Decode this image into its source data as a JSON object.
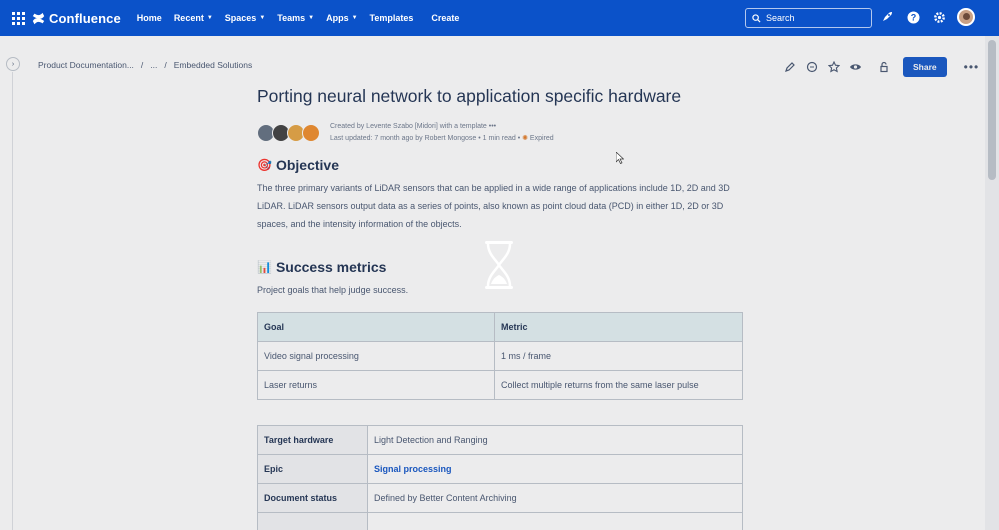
{
  "nav": {
    "brand": "Confluence",
    "items": [
      {
        "label": "Home",
        "has_menu": false
      },
      {
        "label": "Recent",
        "has_menu": true
      },
      {
        "label": "Spaces",
        "has_menu": true
      },
      {
        "label": "Teams",
        "has_menu": true
      },
      {
        "label": "Apps",
        "has_menu": true
      },
      {
        "label": "Templates",
        "has_menu": false
      }
    ],
    "create_label": "Create",
    "search_placeholder": "Search"
  },
  "breadcrumb": {
    "space": "Product Documentation...",
    "sep": "/",
    "ellipsis": "...",
    "page": "Embedded Solutions"
  },
  "toolbar": {
    "share_label": "Share",
    "more_label": "•••"
  },
  "page": {
    "title": "Porting neural network to application specific hardware",
    "created_by": "Created by Levente Szabo [Midori] with a template",
    "created_more": "•••",
    "last_updated": "Last updated: 7 month ago by Robert Mongose",
    "read_time": "1 min read",
    "status": "Expired",
    "avatar_colors": [
      "#5f6d7e",
      "#3a3a3a",
      "#e6a23c",
      "#f08a24"
    ]
  },
  "objective": {
    "icon": "target-icon",
    "heading": "Objective",
    "text": "The three primary variants of LiDAR sensors that can be applied in a wide range of applications include 1D, 2D and 3D LiDAR. LiDAR sensors output data as a series of points, also known as point cloud data (PCD) in either 1D, 2D or 3D spaces, and the intensity information of the objects."
  },
  "success": {
    "icon": "bar-chart-icon",
    "heading": "Success metrics",
    "sub": "Project goals that help judge success.",
    "headers": [
      "Goal",
      "Metric"
    ],
    "rows": [
      [
        "Video signal processing",
        "1 ms / frame"
      ],
      [
        "Laser returns",
        "Collect multiple returns from the same laser pulse"
      ]
    ]
  },
  "properties": [
    {
      "key": "Target hardware",
      "value": "Light Detection and Ranging",
      "link": false
    },
    {
      "key": "Epic",
      "value": "Signal processing",
      "link": true
    },
    {
      "key": "Document status",
      "value": "Defined by Better Content Archiving",
      "link": false
    }
  ],
  "colors": {
    "nav_bg": "#0b52c9",
    "accent": "#0b52c9",
    "table_header_bg": "#e3f1f4",
    "expired": "#e2761d"
  }
}
